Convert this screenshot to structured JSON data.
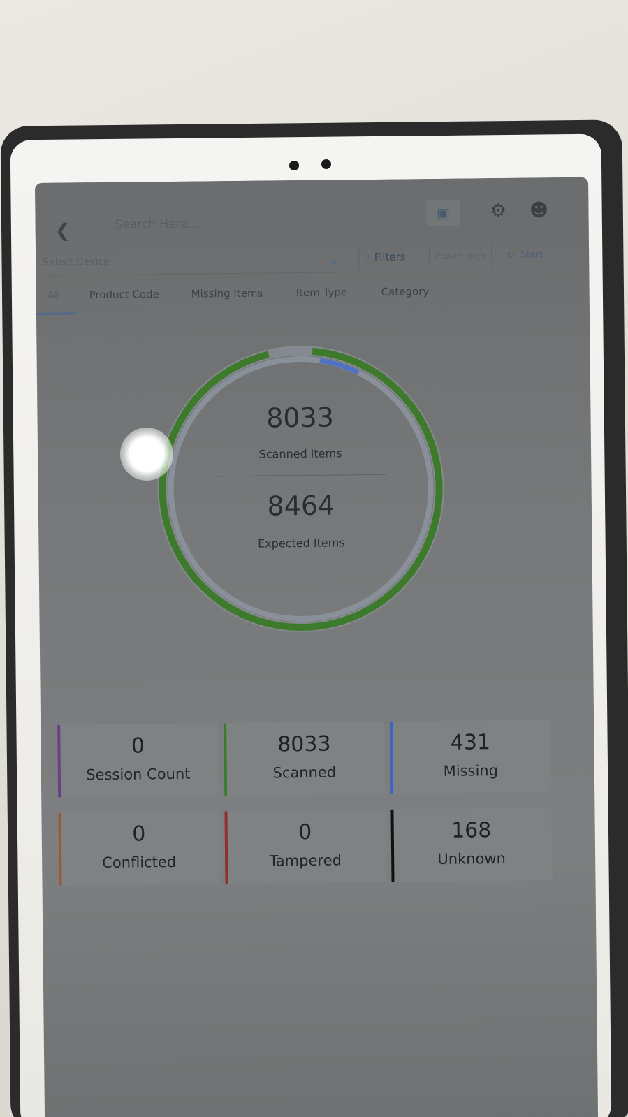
{
  "header": {
    "back_icon": "chevron-left-icon",
    "search_placeholder": "Search Here...",
    "scan_icon": "scan-icon",
    "settings_icon": "gear-icon",
    "profile_icon": "user-circle-icon"
  },
  "toolbar": {
    "device_placeholder": "Select Device",
    "filters_label": "Filters",
    "power_label": "Power: High",
    "start_label": "Start"
  },
  "tabs": [
    {
      "label": "All",
      "active": true
    },
    {
      "label": "Product Code",
      "active": false
    },
    {
      "label": "Missing Items",
      "active": false
    },
    {
      "label": "Item Type",
      "active": false
    },
    {
      "label": "Category",
      "active": false
    }
  ],
  "summary": {
    "scanned_value": "8033",
    "scanned_label": "Scanned Items",
    "expected_value": "8464",
    "expected_label": "Expected Items",
    "progress_fraction": 0.949,
    "ring_color": "#3e7a2c",
    "accent_color": "#4f72c4"
  },
  "stats": [
    {
      "value": "0",
      "label": "Session Count",
      "color": "#6a3f8e"
    },
    {
      "value": "8033",
      "label": "Scanned",
      "color": "#3e7a2c"
    },
    {
      "value": "431",
      "label": "Missing",
      "color": "#3d64c2"
    },
    {
      "value": "0",
      "label": "Conflicted",
      "color": "#9b5a35"
    },
    {
      "value": "0",
      "label": "Tampered",
      "color": "#8e2e2e"
    },
    {
      "value": "168",
      "label": "Unknown",
      "color": "#111111"
    }
  ]
}
